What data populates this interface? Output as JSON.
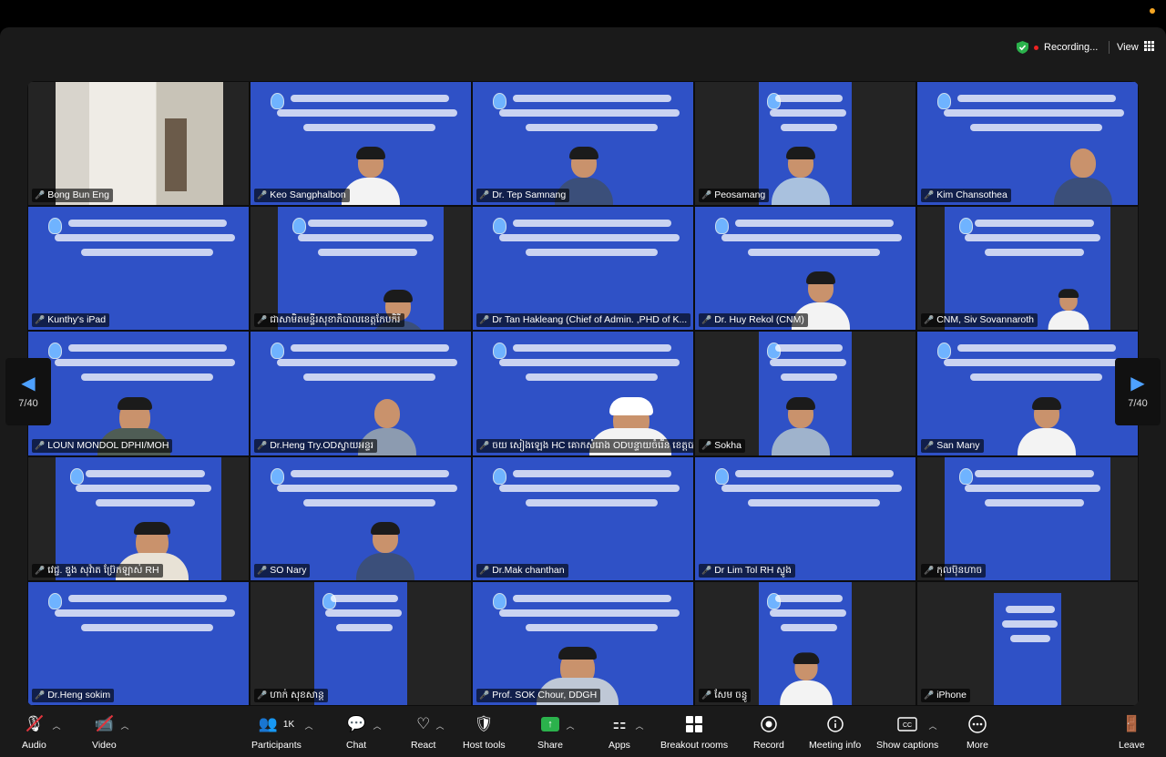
{
  "header": {
    "recording_label": "Recording...",
    "view_label": "View"
  },
  "pagination": {
    "left": "7/40",
    "right": "7/40"
  },
  "participants": [
    {
      "name": "Bong Bun Eng"
    },
    {
      "name": "Keo Sangphalbon"
    },
    {
      "name": "Dr. Tep Samnang"
    },
    {
      "name": "Peosamang"
    },
    {
      "name": "Kim Chansothea"
    },
    {
      "name": "Kunthy's iPad"
    },
    {
      "name": "ជាសាមិតមន្ទីរសុខាភិបាលខេត្តកែបកិរី"
    },
    {
      "name": "Dr Tan Hakleang (Chief of Admin. ,PHD of  K..."
    },
    {
      "name": "Dr. Huy Rekol (CNM)"
    },
    {
      "name": "CNM, Siv Sovannaroth"
    },
    {
      "name": "LOUN MONDOL DPHI/MOH"
    },
    {
      "name": "Dr.Heng Try.ODស្វាយអន្ទរ"
    },
    {
      "name": "ចយ សៀងឡេង HC គោកសំរោង ODបន្ទាយចំរើន ខេត្តបាត់ដំបង"
    },
    {
      "name": "Sokha"
    },
    {
      "name": "San Many"
    },
    {
      "name": "វេជ្ជ. ឌួង សុវ៉ាត ប្រ៊ែកឡាស់ RH"
    },
    {
      "name": "SO Nary"
    },
    {
      "name": "Dr.Mak chanthan"
    },
    {
      "name": "Dr Lim Tol RH ស្ទូង"
    },
    {
      "name": "កុលប៊ុនហាច"
    },
    {
      "name": "Dr.Heng sokim"
    },
    {
      "name": "ហាក់ សុខសាន្ត"
    },
    {
      "name": "Prof. SOK Chour, DDGH"
    },
    {
      "name": "សែម ចន្ធូ"
    },
    {
      "name": "iPhone"
    }
  ],
  "toolbar": {
    "audio": "Audio",
    "video": "Video",
    "participants": "Participants",
    "participants_count": "1K",
    "chat": "Chat",
    "react": "React",
    "host_tools": "Host tools",
    "share": "Share",
    "apps": "Apps",
    "breakout_rooms": "Breakout rooms",
    "record": "Record",
    "meeting_info": "Meeting info",
    "show_captions": "Show captions",
    "more": "More",
    "leave": "Leave"
  },
  "colors": {
    "slide_blue": "#2f51c6",
    "accent_blue": "#4ea1ff",
    "mute_red": "#e0343c",
    "share_green": "#2bb24c"
  }
}
